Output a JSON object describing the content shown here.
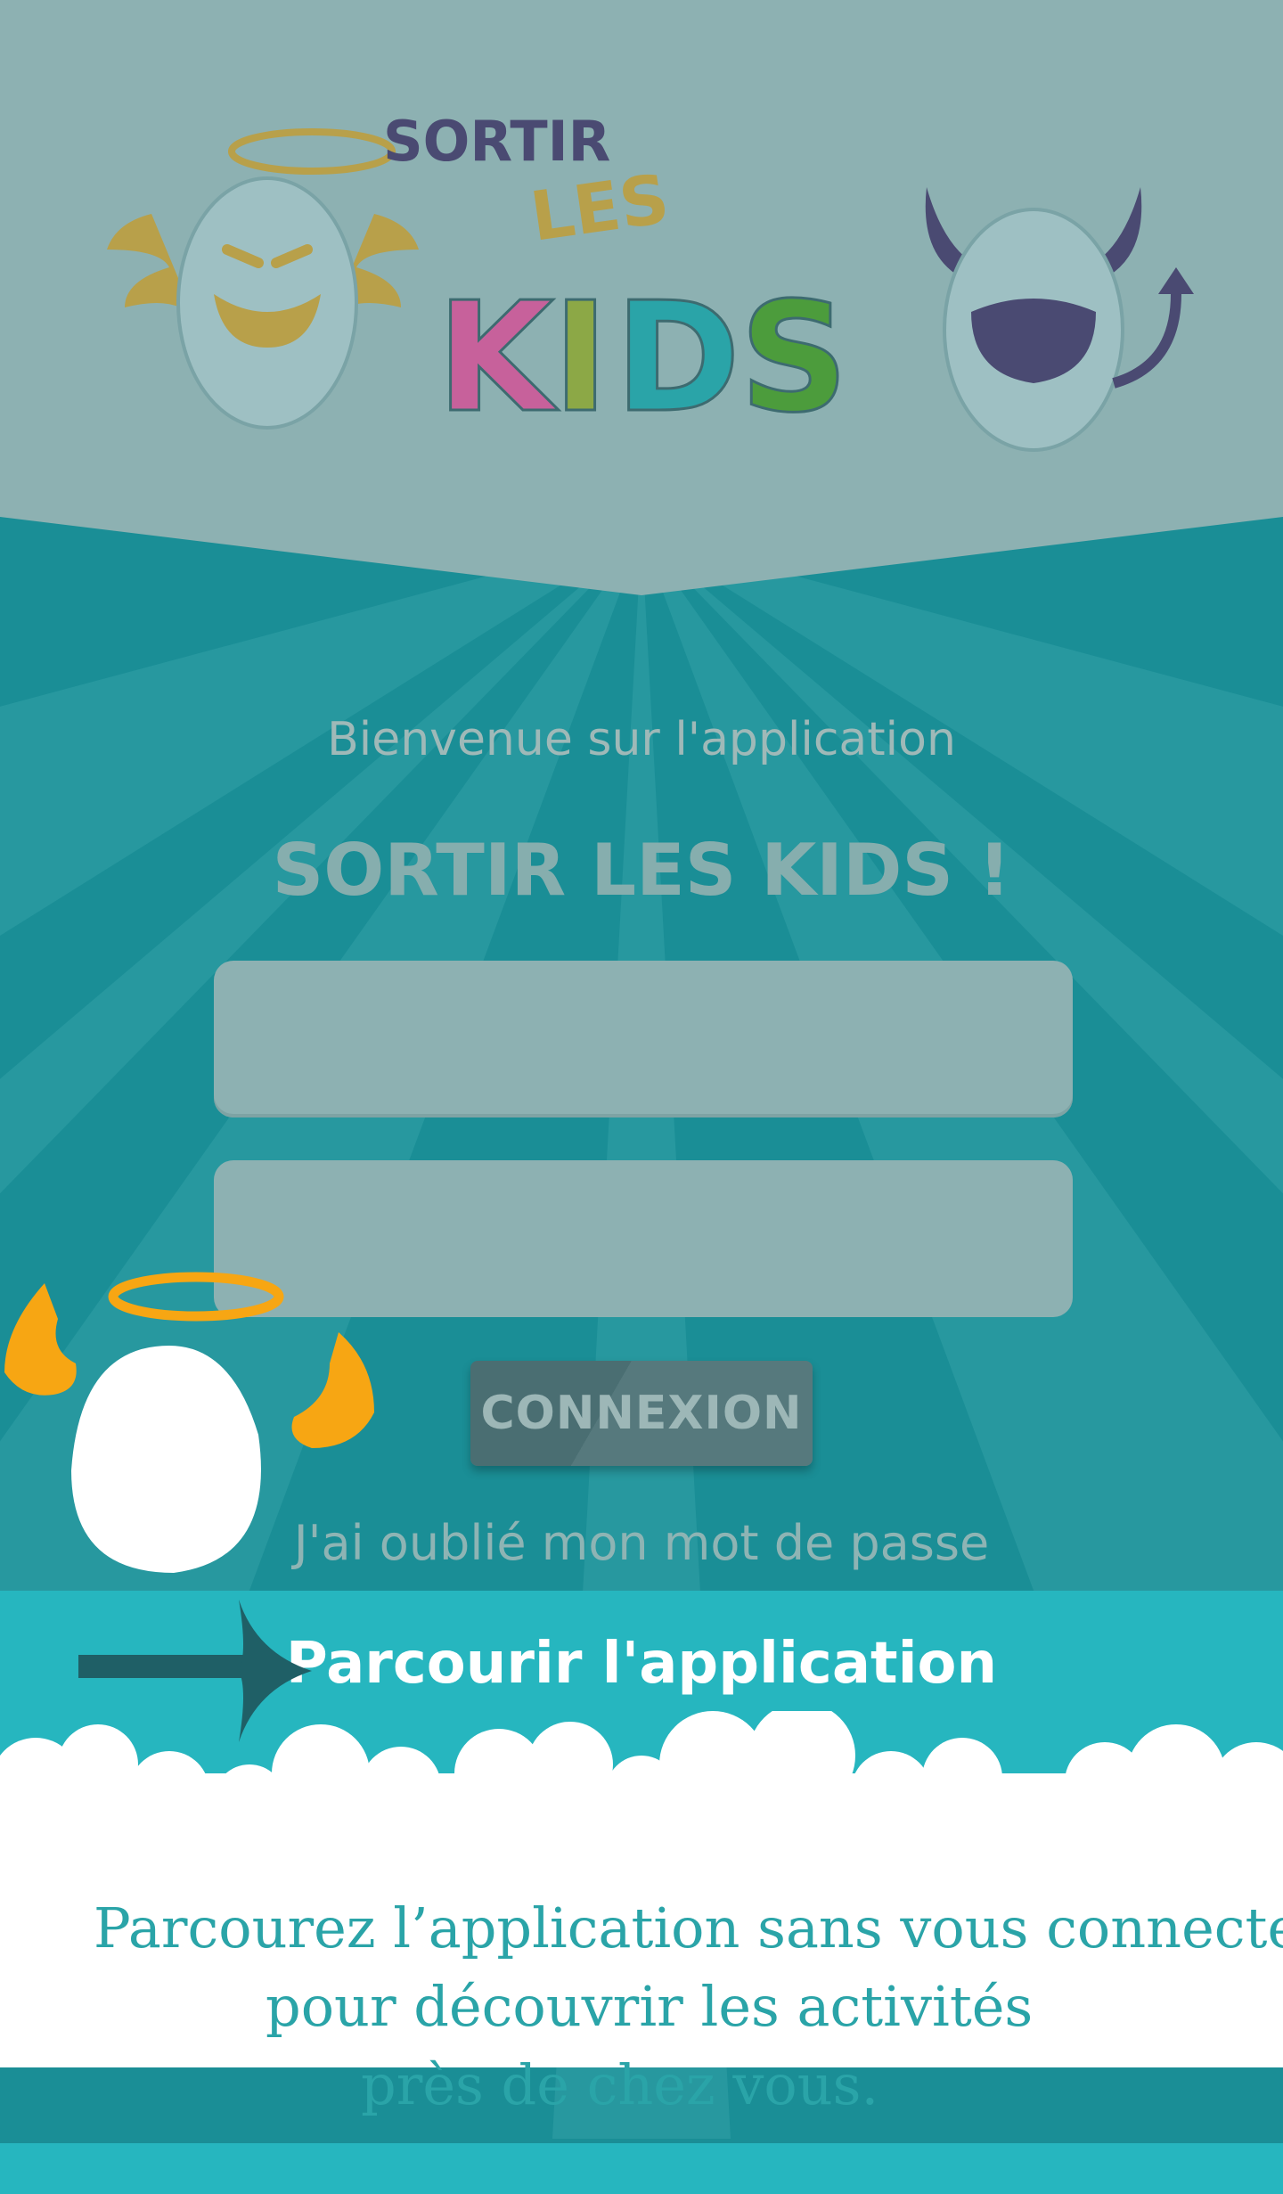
{
  "logo": {
    "line1": "SORTIR",
    "line2": "LES",
    "line3": "KIDS"
  },
  "welcome_text": "Bienvenue sur l'application",
  "app_title": "SORTIR LES KIDS !",
  "login": {
    "username_placeholder": "",
    "password_placeholder": "",
    "submit_label": "CONNEXION",
    "forgot_password": "J'ai oublié mon mot de passe"
  },
  "browse": {
    "label": "Parcourir l'application"
  },
  "promo": {
    "line1": "Parcourez l’application sans vous connectez",
    "line2": "pour découvrir les activités",
    "line3": "près de chez vous."
  },
  "colors": {
    "header_bg": "#8db1b2",
    "ray_dark": "#1a8e96",
    "ray_light": "#2a9aa1",
    "band_accent": "#26b6bf",
    "promo_text": "#2aa4a8",
    "mascot_wings": "#f7a613"
  }
}
